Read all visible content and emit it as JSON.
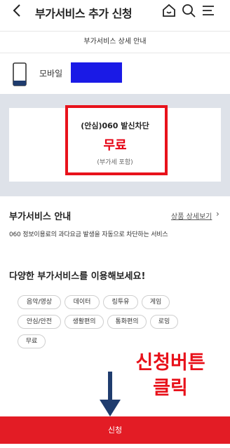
{
  "header": {
    "back_icon": "chevron-left-icon",
    "title": "부가서비스 추가 신청",
    "icons": [
      "home-icon",
      "search-icon",
      "menu-icon"
    ]
  },
  "subtitle": "부가서비스 상세 안내",
  "device": {
    "icon": "mobile-phone-icon",
    "label": "모바일",
    "redaction_color": "#1a1ae6"
  },
  "service": {
    "name": "(안심)060 발신차단",
    "price": "무료",
    "vat_note": "(부가세 포함)"
  },
  "info": {
    "title": "부가서비스 안내",
    "detail_link": "상품 상세보기",
    "description": "060 정보이용료의 과다요금 발생을 자동으로 차단하는 서비스"
  },
  "promo": {
    "title": "다양한 부가서비스를 이용해보세요!",
    "chips": [
      "음악/영상",
      "데이터",
      "링투유",
      "게임",
      "안심/안전",
      "생활편의",
      "통화편의",
      "로밍",
      "무료"
    ]
  },
  "annotation": {
    "line1": "신청버튼",
    "line2": "클릭"
  },
  "apply_button": "신청",
  "colors": {
    "accent_red": "#e31c25",
    "highlight_red": "#e8121b",
    "price_red": "#e60012",
    "panel_gray": "#dee2e9",
    "arrow_navy": "#1f3c6e"
  }
}
